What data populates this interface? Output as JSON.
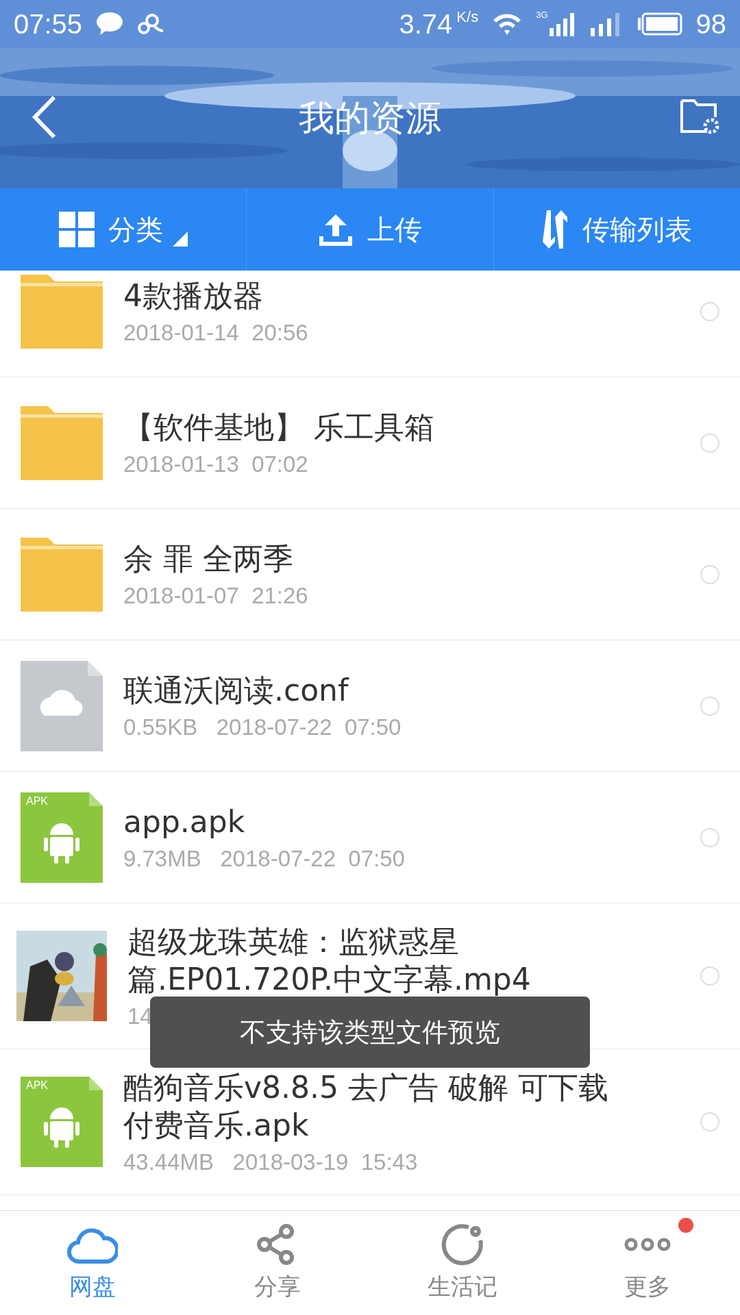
{
  "status_bar": {
    "time": "07:55",
    "speed": "3.74",
    "speed_unit": "K/s",
    "network": "3G",
    "battery": "98"
  },
  "header": {
    "title": "我的资源"
  },
  "toolbar": [
    {
      "kind": "grid",
      "label": "分类",
      "dropdown": true
    },
    {
      "kind": "upload",
      "label": "上传",
      "dropdown": false
    },
    {
      "kind": "transfer",
      "label": "传输列表",
      "dropdown": false
    }
  ],
  "files": [
    {
      "kind": "folder",
      "name": "4款播放器",
      "meta": "2018-01-14  20:56",
      "selected": false
    },
    {
      "kind": "folder",
      "name": "【软件基地】 乐工具箱",
      "meta": "2018-01-13  07:02",
      "selected": false
    },
    {
      "kind": "folder",
      "name": "余 罪 全两季",
      "meta": "2018-01-07  21:26",
      "selected": false
    },
    {
      "kind": "cloud",
      "name": "联通沃阅读.conf",
      "meta": "0.55KB   2018-07-22  07:50",
      "selected": false
    },
    {
      "kind": "apk",
      "badge": "APK",
      "name": "app.apk",
      "meta": "9.73MB   2018-07-22  07:50",
      "selected": false
    },
    {
      "kind": "video",
      "name": "超级龙珠英雄：监狱惑星篇.EP01.720P.中文字幕.mp4",
      "meta": "14",
      "selected": false
    },
    {
      "kind": "apk",
      "badge": "APK",
      "name": "酷狗音乐v8.8.5 去广告 破解 可下载付费音乐.apk",
      "meta": "43.44MB   2018-03-19  15:43",
      "selected": false
    }
  ],
  "toast": "不支持该类型文件预览",
  "tabs": [
    {
      "kind": "cloud",
      "label": "网盘",
      "selected": true,
      "badge": false
    },
    {
      "kind": "share",
      "label": "分享",
      "selected": false,
      "badge": false
    },
    {
      "kind": "life",
      "label": "生活记",
      "selected": false,
      "badge": false
    },
    {
      "kind": "more",
      "label": "更多",
      "selected": false,
      "badge": true
    }
  ]
}
